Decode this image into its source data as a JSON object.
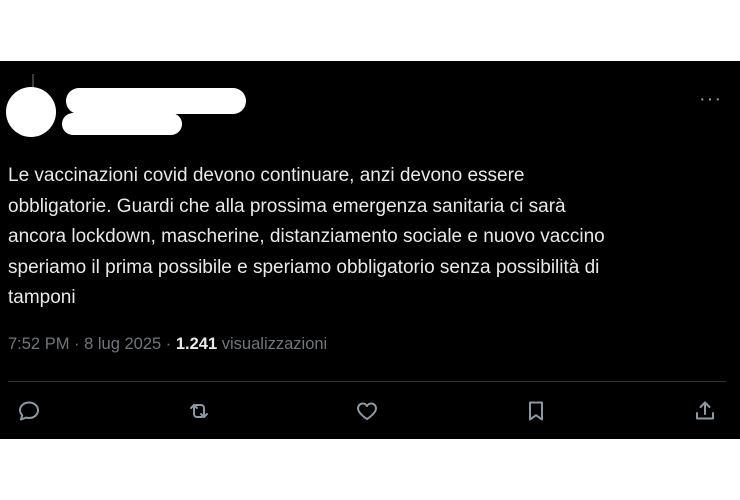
{
  "post": {
    "text": "Le vaccinazioni covid devono continuare, anzi devono essere\nobbligatorie. Guardi che alla prossima emergenza sanitaria ci sarà\nancora lockdown, mascherine, distanziamento sociale e nuovo vaccino\nsperiamo il prima possibile e speriamo obbligatorio senza possibilità di\ntamponi",
    "time": "7:52 PM",
    "sep1": " · ",
    "date": "8 lug 2025",
    "sep2": " · ",
    "views_count": "1.241",
    "views_label": " visualizzazioni",
    "more_label": "···"
  },
  "actions": [
    {
      "name": "reply",
      "icon": "reply-icon"
    },
    {
      "name": "repost",
      "icon": "repost-icon"
    },
    {
      "name": "like",
      "icon": "heart-icon"
    },
    {
      "name": "bookmark",
      "icon": "bookmark-icon"
    },
    {
      "name": "share",
      "icon": "share-icon"
    }
  ],
  "colors": {
    "background": "#000000",
    "text": "#e7e9ea",
    "muted": "#71767b",
    "icon": "#8b98a5",
    "divider": "#2f3336"
  }
}
